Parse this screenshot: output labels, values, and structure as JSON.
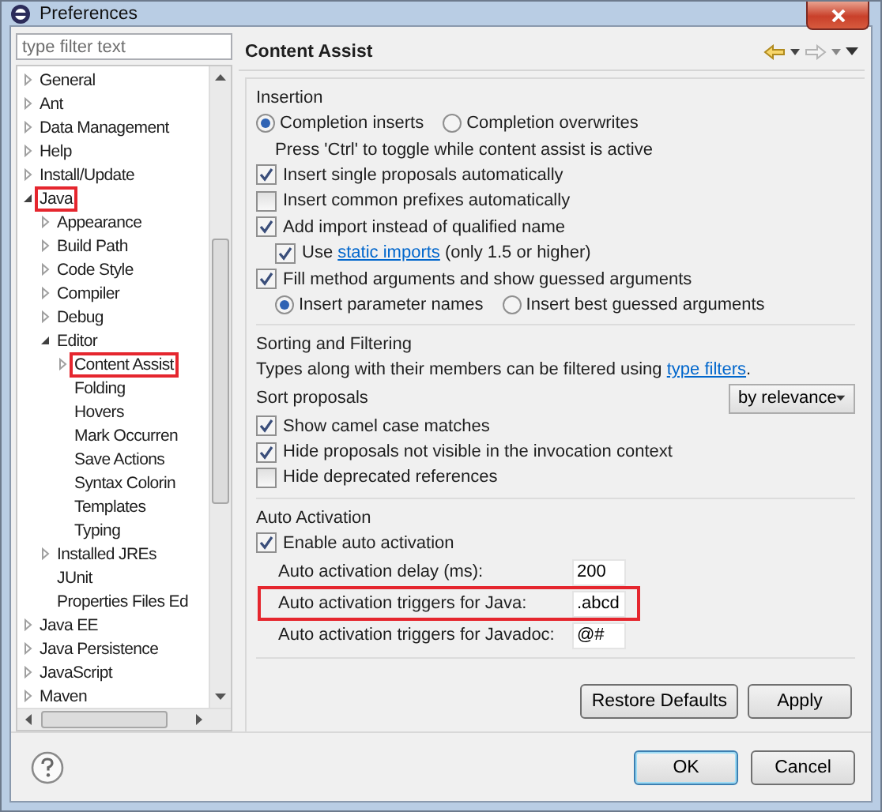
{
  "window": {
    "title": "Preferences"
  },
  "filter": {
    "placeholder": "type filter text"
  },
  "tree": [
    {
      "label": "General",
      "expanded": false,
      "highlighted": false
    },
    {
      "label": "Ant",
      "expanded": false,
      "highlighted": false
    },
    {
      "label": "Data Management",
      "expanded": false,
      "highlighted": false
    },
    {
      "label": "Help",
      "expanded": false,
      "highlighted": false
    },
    {
      "label": "Install/Update",
      "expanded": false,
      "highlighted": false
    },
    {
      "label": "Java",
      "expanded": true,
      "highlighted": true,
      "children": [
        {
          "label": "Appearance",
          "expanded": false,
          "highlighted": false
        },
        {
          "label": "Build Path",
          "expanded": false,
          "highlighted": false
        },
        {
          "label": "Code Style",
          "expanded": false,
          "highlighted": false
        },
        {
          "label": "Compiler",
          "expanded": false,
          "highlighted": false
        },
        {
          "label": "Debug",
          "expanded": false,
          "highlighted": false
        },
        {
          "label": "Editor",
          "expanded": true,
          "highlighted": false,
          "children": [
            {
              "label": "Content Assist",
              "expanded": false,
              "highlighted": true
            },
            {
              "label": "Folding",
              "highlighted": false
            },
            {
              "label": "Hovers",
              "highlighted": false
            },
            {
              "label": "Mark Occurren",
              "highlighted": false
            },
            {
              "label": "Save Actions",
              "highlighted": false
            },
            {
              "label": "Syntax Colorin",
              "highlighted": false
            },
            {
              "label": "Templates",
              "highlighted": false
            },
            {
              "label": "Typing",
              "highlighted": false
            }
          ]
        },
        {
          "label": "Installed JREs",
          "expanded": false,
          "highlighted": false
        },
        {
          "label": "JUnit",
          "highlighted": false
        },
        {
          "label": "Properties Files Ed",
          "highlighted": false
        }
      ]
    },
    {
      "label": "Java EE",
      "expanded": false,
      "highlighted": false
    },
    {
      "label": "Java Persistence",
      "expanded": false,
      "highlighted": false
    },
    {
      "label": "JavaScript",
      "expanded": false,
      "highlighted": false
    },
    {
      "label": "Maven",
      "expanded": false,
      "highlighted": false
    }
  ],
  "page_title": "Content Assist",
  "sections": [
    {
      "title": "Insertion",
      "items": [
        {
          "kind": "radios",
          "options": [
            {
              "label": "Completion inserts",
              "selected": true
            },
            {
              "label": "Completion overwrites",
              "selected": false
            }
          ]
        },
        {
          "kind": "note",
          "text": "Press 'Ctrl' to toggle while content assist is active"
        },
        {
          "kind": "checkbox",
          "label": "Insert single proposals automatically",
          "checked": true
        },
        {
          "kind": "checkbox",
          "label": "Insert common prefixes automatically",
          "checked": false
        },
        {
          "kind": "checkbox",
          "label": "Add import instead of qualified name",
          "checked": true,
          "children": [
            {
              "kind": "checkbox",
              "label": "Use",
              "link": "static imports",
              "suffix": "(only 1.5 or higher)",
              "checked": true
            }
          ]
        },
        {
          "kind": "checkbox",
          "label": "Fill method arguments and show guessed arguments",
          "checked": true,
          "children": [
            {
              "kind": "radios",
              "options": [
                {
                  "label": "Insert parameter names",
                  "selected": true
                },
                {
                  "label": "Insert best guessed arguments",
                  "selected": false
                }
              ]
            }
          ]
        }
      ]
    },
    {
      "title": "Sorting and Filtering",
      "items": [
        {
          "kind": "text",
          "text": "Types along with their members can be filtered using",
          "link": "type filters",
          "suffix": "."
        },
        {
          "kind": "select",
          "label": "Sort proposals",
          "value": "by relevance"
        },
        {
          "kind": "checkbox",
          "label": "Show camel case matches",
          "checked": true
        },
        {
          "kind": "checkbox",
          "label": "Hide proposals not visible in the invocation context",
          "checked": true
        },
        {
          "kind": "checkbox",
          "label": "Hide deprecated references",
          "checked": false
        }
      ]
    },
    {
      "title": "Auto Activation",
      "items": [
        {
          "kind": "checkbox",
          "label": "Enable auto activation",
          "checked": true,
          "children": [
            {
              "kind": "field",
              "label": "Auto activation delay (ms):",
              "value": "200",
              "highlighted": false
            },
            {
              "kind": "field",
              "label": "Auto activation triggers for Java:",
              "value": ".abcd",
              "highlighted": true
            },
            {
              "kind": "field",
              "label": "Auto activation triggers for Javadoc:",
              "value": "@#",
              "highlighted": false
            }
          ]
        }
      ]
    }
  ],
  "page_buttons": [
    "Restore Defaults",
    "Apply"
  ],
  "dialog_buttons": [
    {
      "label": "OK",
      "default": true
    },
    {
      "label": "Cancel",
      "default": false
    }
  ]
}
